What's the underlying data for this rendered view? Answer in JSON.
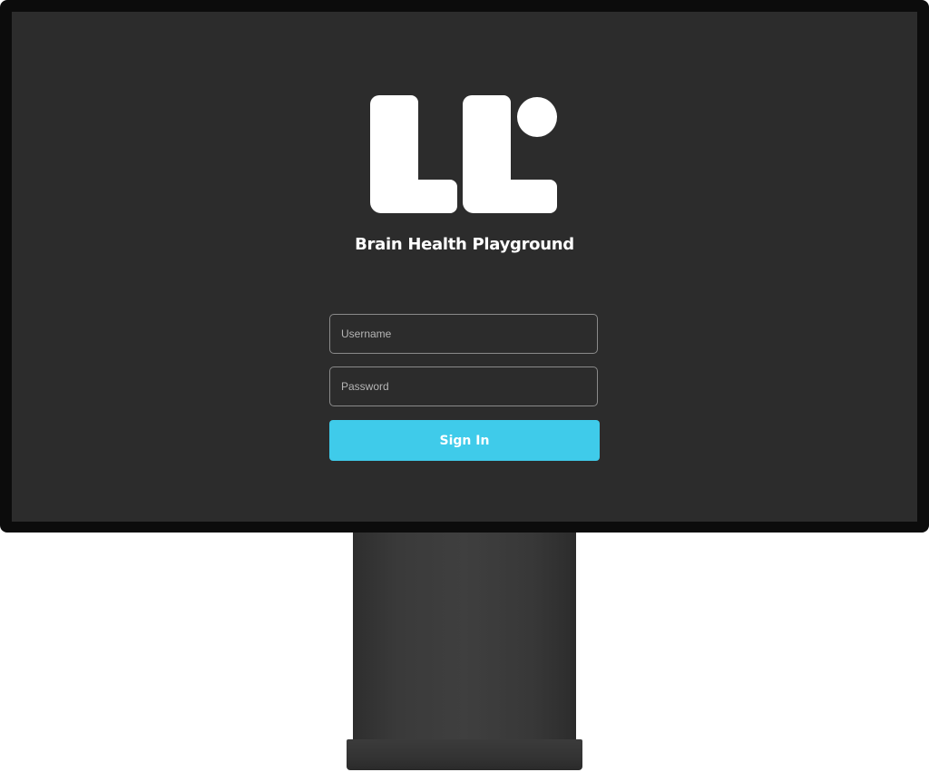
{
  "app": {
    "title": "Brain Health Playground"
  },
  "logo": {
    "icon": "ll-dot-logo"
  },
  "login": {
    "username_placeholder": "Username",
    "password_placeholder": "Password",
    "signin_label": "Sign In"
  },
  "colors": {
    "screen_background": "#2c2c2c",
    "bezel": "#0c0c0c",
    "button_accent": "#3fcbea",
    "text": "#ffffff"
  }
}
